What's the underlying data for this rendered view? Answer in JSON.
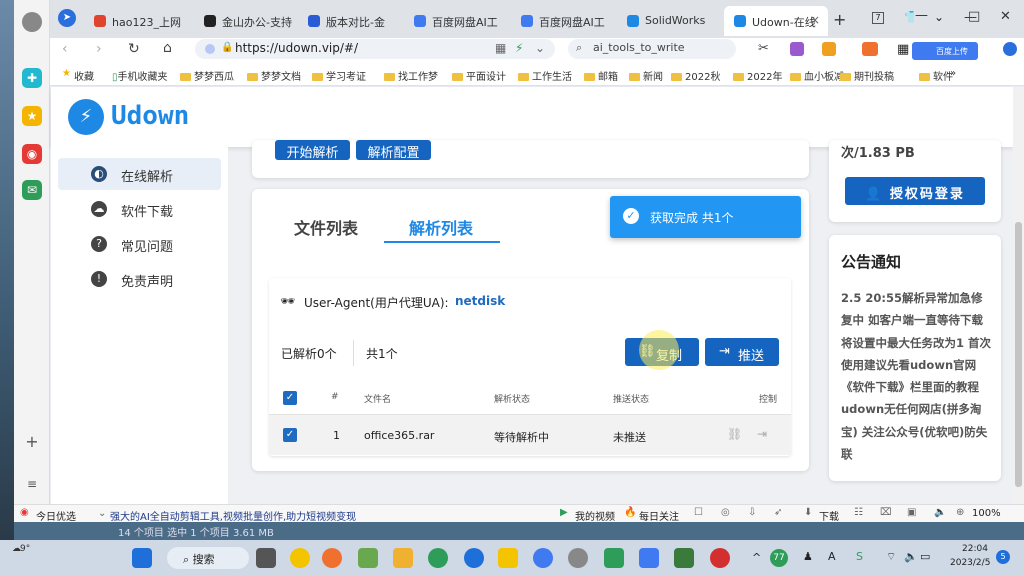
{
  "tabs": [
    {
      "label": "hao123_上网",
      "color": "#e0442e"
    },
    {
      "label": "金山办公-支持",
      "color": "#222222"
    },
    {
      "label": "版本对比-金",
      "color": "#2a5bd7"
    },
    {
      "label": "百度网盘AI工",
      "color": "#3f7af0"
    },
    {
      "label": "百度网盘AI工",
      "color": "#3f7af0"
    },
    {
      "label": "SolidWorks",
      "color": "#1e88e5"
    },
    {
      "label": "Udown-在线",
      "color": "#1e88e5"
    }
  ],
  "new_tab": "+",
  "window": {
    "minimize": "—",
    "maximize": "□",
    "close": "✕"
  },
  "address": {
    "url": "https://udown.vip/#/",
    "search": "ai_tools_to_write",
    "ext_label": "百度上传"
  },
  "bookmarks": [
    "收藏",
    "手机收藏夹",
    "梦梦西瓜",
    "梦梦文档",
    "学习考证",
    "找工作梦",
    "平面设计",
    "工作生活",
    "邮箱",
    "新闻",
    "2022秋",
    "2022年",
    "血小板减",
    "期刊投稿",
    "软件"
  ],
  "bookmarks_more": "»",
  "logo": "Udown",
  "nav": [
    {
      "label": "在线解析",
      "icon": "globe-icon",
      "active": true
    },
    {
      "label": "软件下载",
      "icon": "cloud-download-icon",
      "active": false
    },
    {
      "label": "常见问题",
      "icon": "question-icon",
      "active": false
    },
    {
      "label": "免责声明",
      "icon": "exclamation-icon",
      "active": false
    }
  ],
  "top_buttons": [
    "开始解析",
    "解析配置"
  ],
  "list_tabs": [
    "文件列表",
    "解析列表"
  ],
  "toast": "获取完成 共1个",
  "ua_label": "User-Agent(用户代理UA):",
  "ua_value": "netdisk",
  "parsed_count": "已解析0个",
  "total_count": "共1个",
  "copy_btn": "复制",
  "push_btn": "推送",
  "table": {
    "headers": [
      "#",
      "文件名",
      "解析状态",
      "推送状态",
      "控制"
    ],
    "rows": [
      {
        "index": "1",
        "name": "office365.rar",
        "status": "等待解析中",
        "push": "未推送"
      }
    ]
  },
  "quota": "次/1.83 PB",
  "login_btn": "授权码登录",
  "notice_title": "公告通知",
  "notice_text": "2.5 20:55解析异常加急修复中 如客户端一直等待下载 将设置中最大任务改为1 首次使用建议先看udown官网《软件下载》栏里面的教程 udown无任何网店(拼多淘宝) 关注公众号(优软吧)防失联",
  "status_bar": {
    "left": "今日优选",
    "ad": "强大的AI全自动剪辑工具,视频批量创作,助力短视频变现",
    "video": "我的视频",
    "follow": "每日关注",
    "download": "下载",
    "zoom": "100%"
  },
  "taskbar": {
    "weather": "9°",
    "search": "搜索",
    "badge": "77",
    "time": "22:04",
    "date": "2023/2/5",
    "ime": "A",
    "notif": "5"
  },
  "behind_text": "14 个项目 选中 1 个项目 3.61 MB"
}
